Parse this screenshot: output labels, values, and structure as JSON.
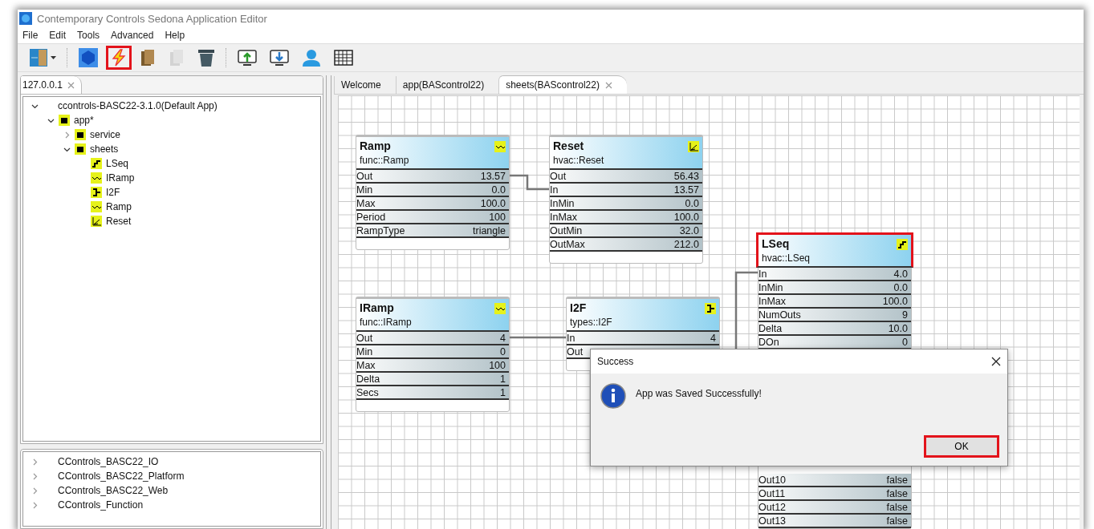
{
  "window": {
    "title": "Contemporary Controls Sedona Application Editor"
  },
  "menu": [
    "File",
    "Edit",
    "Tools",
    "Advanced",
    "Help"
  ],
  "toolbar": [
    {
      "kind": "layout",
      "highlighted": false,
      "disabled": false
    },
    {
      "kind": "hex",
      "highlighted": false,
      "disabled": false
    },
    {
      "kind": "bolt",
      "highlighted": true,
      "disabled": false
    },
    {
      "kind": "paste",
      "highlighted": false,
      "disabled": false
    },
    {
      "kind": "copy",
      "highlighted": false,
      "disabled": true
    },
    {
      "kind": "trash",
      "highlighted": false,
      "disabled": false
    },
    {
      "kind": "upload",
      "highlighted": false,
      "disabled": false
    },
    {
      "kind": "download",
      "highlighted": false,
      "disabled": false
    },
    {
      "kind": "person",
      "highlighted": false,
      "disabled": false
    },
    {
      "kind": "table",
      "highlighted": false,
      "disabled": false
    }
  ],
  "device_panel": {
    "tab": "127.0.0.1",
    "tree": [
      {
        "label": "ccontrols-BASC22-3.1.0(Default App)",
        "kind": "root",
        "expanded": true,
        "children": [
          {
            "label": "app*",
            "kind": "folder",
            "expanded": true,
            "children": [
              {
                "label": "service",
                "kind": "folder",
                "expanded": false
              },
              {
                "label": "sheets",
                "kind": "folder",
                "expanded": true,
                "children": [
                  {
                    "label": "LSeq",
                    "kind": "step"
                  },
                  {
                    "label": "IRamp",
                    "kind": "wave"
                  },
                  {
                    "label": "I2F",
                    "kind": "convert"
                  },
                  {
                    "label": "Ramp",
                    "kind": "wave"
                  },
                  {
                    "label": "Reset",
                    "kind": "reset"
                  }
                ]
              }
            ]
          }
        ]
      }
    ]
  },
  "kits_panel": {
    "items": [
      {
        "label": "CControls_BASC22_IO",
        "expanded": false
      },
      {
        "label": "CControls_BASC22_Platform",
        "expanded": false
      },
      {
        "label": "CControls_BASC22_Web",
        "expanded": false
      },
      {
        "label": "CControls_Function",
        "expanded": false
      }
    ]
  },
  "editor_tabs": [
    {
      "label": "Welcome",
      "selected": false
    },
    {
      "label": "app(BAScontrol22)",
      "selected": false
    },
    {
      "label": "sheets(BAScontrol22)",
      "selected": true
    }
  ],
  "nodes": [
    {
      "name": "Ramp",
      "type": "func::Ramp",
      "kind": "wave",
      "highlighted": false,
      "rows": [
        {
          "label": "Out",
          "value": "13.57"
        },
        {
          "label": "Min",
          "value": "0.0"
        },
        {
          "label": "Max",
          "value": "100.0"
        },
        {
          "label": "Period",
          "value": "100"
        },
        {
          "label": "RampType",
          "value": "triangle"
        }
      ]
    },
    {
      "name": "Reset",
      "type": "hvac::Reset",
      "kind": "reset",
      "highlighted": false,
      "rows": [
        {
          "label": "Out",
          "value": "56.43"
        },
        {
          "label": "In",
          "value": "13.57"
        },
        {
          "label": "InMin",
          "value": "0.0"
        },
        {
          "label": "InMax",
          "value": "100.0"
        },
        {
          "label": "OutMin",
          "value": "32.0"
        },
        {
          "label": "OutMax",
          "value": "212.0"
        }
      ]
    },
    {
      "name": "LSeq",
      "type": "hvac::LSeq",
      "kind": "step",
      "highlighted": true,
      "rows": [
        {
          "label": "In",
          "value": "4.0"
        },
        {
          "label": "InMin",
          "value": "0.0"
        },
        {
          "label": "InMax",
          "value": "100.0"
        },
        {
          "label": "NumOuts",
          "value": "9"
        },
        {
          "label": "Delta",
          "value": "10.0"
        },
        {
          "label": "DOn",
          "value": "0"
        }
      ],
      "rows_below_dialog": [
        {
          "label": "Out10",
          "value": "false"
        },
        {
          "label": "Out11",
          "value": "false"
        },
        {
          "label": "Out12",
          "value": "false"
        },
        {
          "label": "Out13",
          "value": "false"
        }
      ]
    },
    {
      "name": "IRamp",
      "type": "func::IRamp",
      "kind": "wave",
      "highlighted": false,
      "rows": [
        {
          "label": "Out",
          "value": "4"
        },
        {
          "label": "Min",
          "value": "0"
        },
        {
          "label": "Max",
          "value": "100"
        },
        {
          "label": "Delta",
          "value": "1"
        },
        {
          "label": "Secs",
          "value": "1"
        }
      ]
    },
    {
      "name": "I2F",
      "type": "types::I2F",
      "kind": "convert",
      "highlighted": false,
      "rows": [
        {
          "label": "In",
          "value": "4"
        },
        {
          "label": "Out"
        }
      ]
    }
  ],
  "dialog": {
    "title": "Success",
    "message": "App was Saved Successfully!",
    "button": {
      "label": "OK",
      "highlighted": true
    }
  }
}
